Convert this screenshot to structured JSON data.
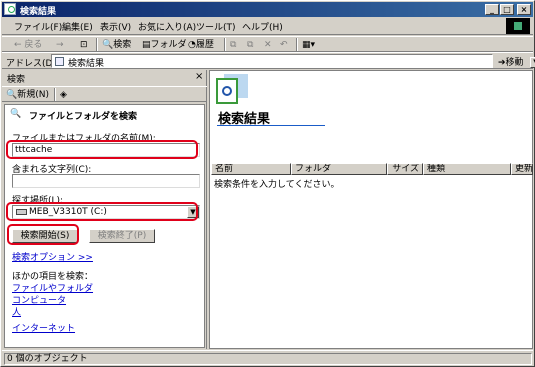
{
  "window": {
    "title": "検索結果"
  },
  "menu": [
    "ファイル(F)",
    "編集(E)",
    "表示(V)",
    "お気に入り(A)",
    "ツール(T)",
    "ヘルプ(H)"
  ],
  "toolbar": {
    "back": "← 戻る",
    "forward": "→",
    "search": "検索",
    "folders": "フォルダ",
    "history": "履歴"
  },
  "address": {
    "label": "アドレス(D)",
    "value": "検索結果",
    "go": "移動"
  },
  "search_pane": {
    "title": "検索",
    "close": "×",
    "new_label": "新規(N)",
    "heading": "ファイルとフォルダを検索",
    "name_label": "ファイルまたはフォルダの名前(M):",
    "name_value": "tttcache",
    "text_label": "含まれる文字列(C):",
    "text_value": "",
    "location_label": "探す場所(L):",
    "location_value": "MEB_V3310T (C:)",
    "start_button": "検索開始(S)",
    "stop_button": "検索終了(P)",
    "options_link": "検索オプション >>",
    "other_items_label": "ほかの項目を検索：",
    "other_links": [
      "ファイルやフォルダ",
      "コンピュータ",
      "人",
      "インターネット"
    ]
  },
  "results": {
    "title": "検索結果",
    "columns": [
      "名前",
      "フォルダ",
      "サイズ",
      "種類",
      "更新日"
    ],
    "message": "検索条件を入力してください。"
  },
  "status": {
    "text": "0 個のオブジェクト"
  },
  "colors": {
    "highlight": "#e0001a",
    "title_bar": "#0a246a",
    "link": "#0000cc"
  }
}
